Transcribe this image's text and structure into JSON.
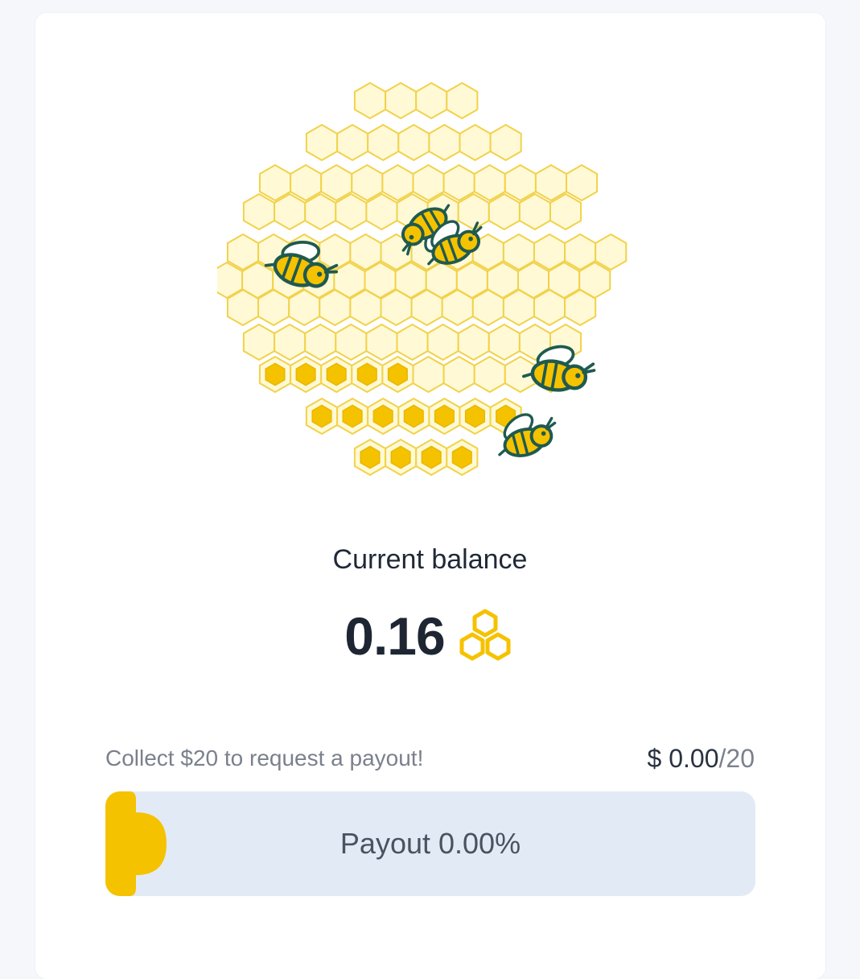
{
  "balance": {
    "label": "Current balance",
    "value": "0.16",
    "currency_icon": "honeycomb-icon"
  },
  "payout": {
    "hint": "Collect $20 to request a payout!",
    "currency_symbol": "$",
    "current": "0.00",
    "separator": "/",
    "goal": "20",
    "progress_label": "Payout 0.00%",
    "progress_fraction": 0.0
  },
  "colors": {
    "accent": "#f5c200",
    "cell_fill": "#fff9d6",
    "cell_stroke": "#f1d24a",
    "progress_track": "#e2ebf5",
    "bee_outline": "#1f5a4f"
  },
  "illustration": {
    "icon": "honeycomb-hive-illustration",
    "bee_icon": "bee-icon"
  }
}
